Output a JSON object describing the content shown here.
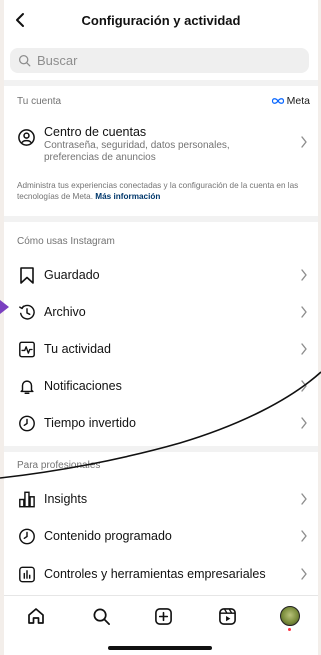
{
  "header": {
    "title": "Configuración y actividad"
  },
  "search": {
    "placeholder": "Buscar"
  },
  "account_section": {
    "label": "Tu cuenta",
    "meta_logo": "Meta",
    "center_title": "Centro de cuentas",
    "center_subtitle": "Contraseña, seguridad, datos personales, preferencias de anuncios",
    "note": "Administra tus experiencias conectadas y la configuración de la cuenta en las tecnologías de Meta.",
    "note_link": "Más información"
  },
  "usage_section": {
    "label": "Cómo usas Instagram",
    "items": [
      {
        "label": "Guardado",
        "icon": "bookmark-icon"
      },
      {
        "label": "Archivo",
        "icon": "archive-icon"
      },
      {
        "label": "Tu actividad",
        "icon": "activity-icon"
      },
      {
        "label": "Notificaciones",
        "icon": "bell-icon"
      },
      {
        "label": "Tiempo invertido",
        "icon": "clock-icon"
      }
    ]
  },
  "pro_section": {
    "label": "Para profesionales",
    "items": [
      {
        "label": "Insights",
        "icon": "bar-chart-icon"
      },
      {
        "label": "Contenido programado",
        "icon": "clock-icon"
      },
      {
        "label": "Controles y herramientas empresariales",
        "icon": "chart-box-icon"
      }
    ]
  },
  "tabbar": {
    "items": [
      "home-icon",
      "search-icon",
      "create-icon",
      "reels-icon",
      "profile-avatar"
    ]
  },
  "colors": {
    "background": "#ffffff",
    "backdrop": "#f3eeea",
    "secondary_text": "#737373",
    "link": "#00376b",
    "annotation_arrow": "#7a3fc0",
    "notification_dot": "#ff3040"
  }
}
